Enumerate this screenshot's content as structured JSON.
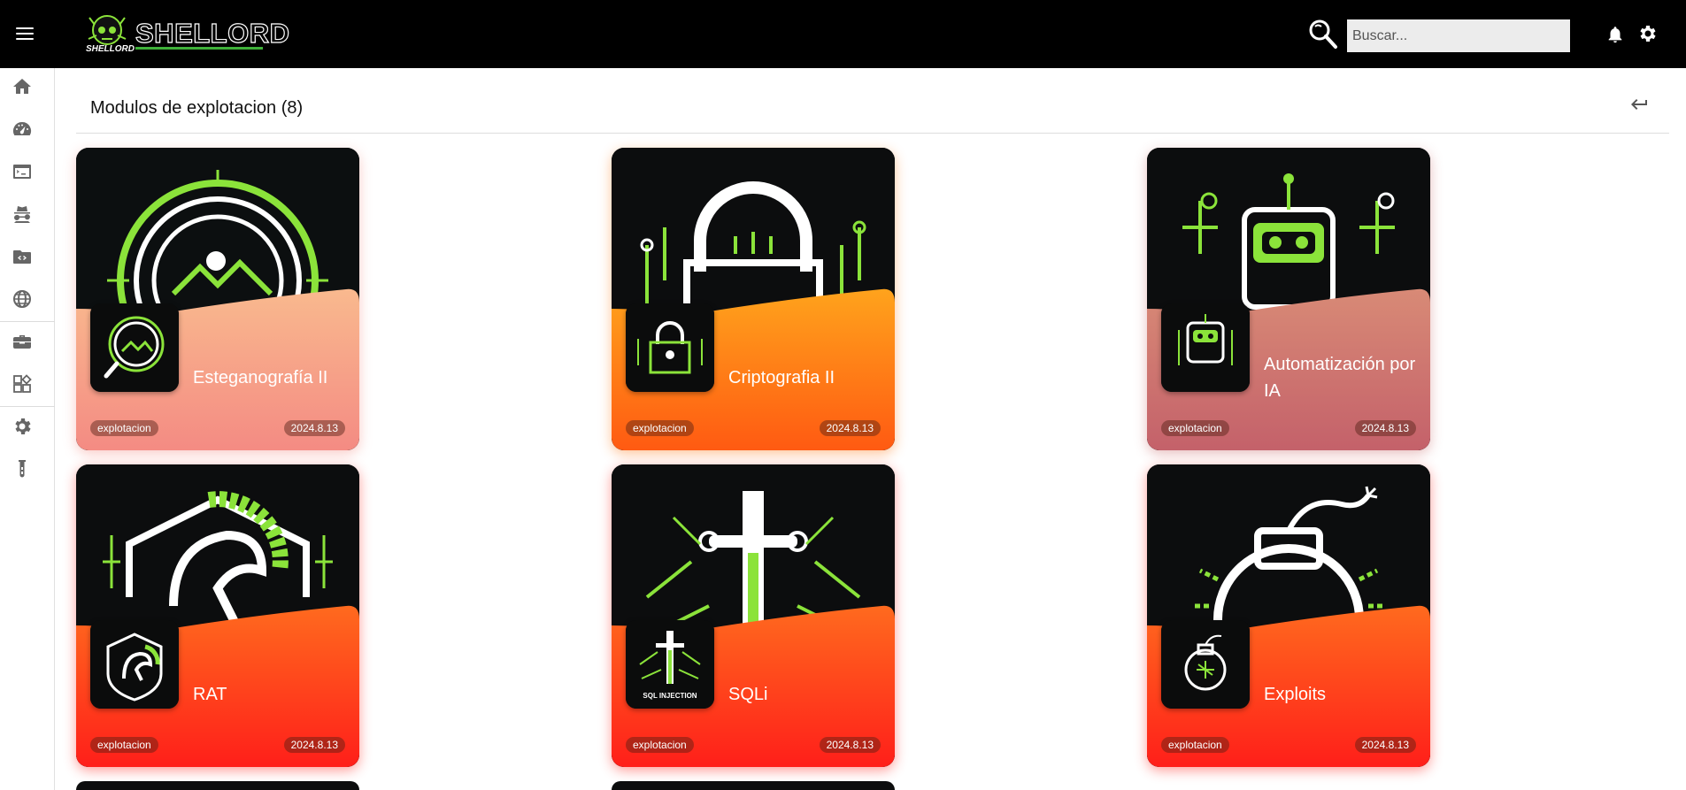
{
  "header": {
    "logo_text": "SHELLORD",
    "logo_sub": "SHELLORD",
    "search_placeholder": "Buscar..."
  },
  "sidebar": {
    "items": [
      {
        "name": "home"
      },
      {
        "name": "dashboard"
      },
      {
        "name": "terminal"
      },
      {
        "name": "spy"
      },
      {
        "name": "folder-code"
      },
      {
        "name": "globe"
      },
      {
        "name": "toolbox"
      },
      {
        "name": "modules"
      },
      {
        "name": "settings"
      },
      {
        "name": "test-tube"
      }
    ]
  },
  "main": {
    "section_title": "Modulos de explotacion (8)",
    "cards": [
      {
        "title": "Esteganografía II",
        "tag": "explotacion",
        "version": "2024.8.13",
        "accent": "#f29a83"
      },
      {
        "title": "Criptografia II",
        "tag": "explotacion",
        "version": "2024.8.13",
        "accent": "#ff7a1a"
      },
      {
        "title": "Automatización por IA",
        "tag": "explotacion",
        "version": "2024.8.13",
        "accent": "#cc6f6f"
      },
      {
        "title": "RAT",
        "tag": "explotacion",
        "version": "2024.8.13",
        "accent": "#ff3f1f"
      },
      {
        "title": "SQLi",
        "tag": "explotacion",
        "version": "2024.8.13",
        "accent": "#ff3f1f"
      },
      {
        "title": "Exploits",
        "tag": "explotacion",
        "version": "2024.8.13",
        "accent": "#ff3f1f"
      }
    ]
  },
  "colors": {
    "topbar": "#000000",
    "neon_green": "#8be33a",
    "logo_green": "#3fb13a"
  }
}
